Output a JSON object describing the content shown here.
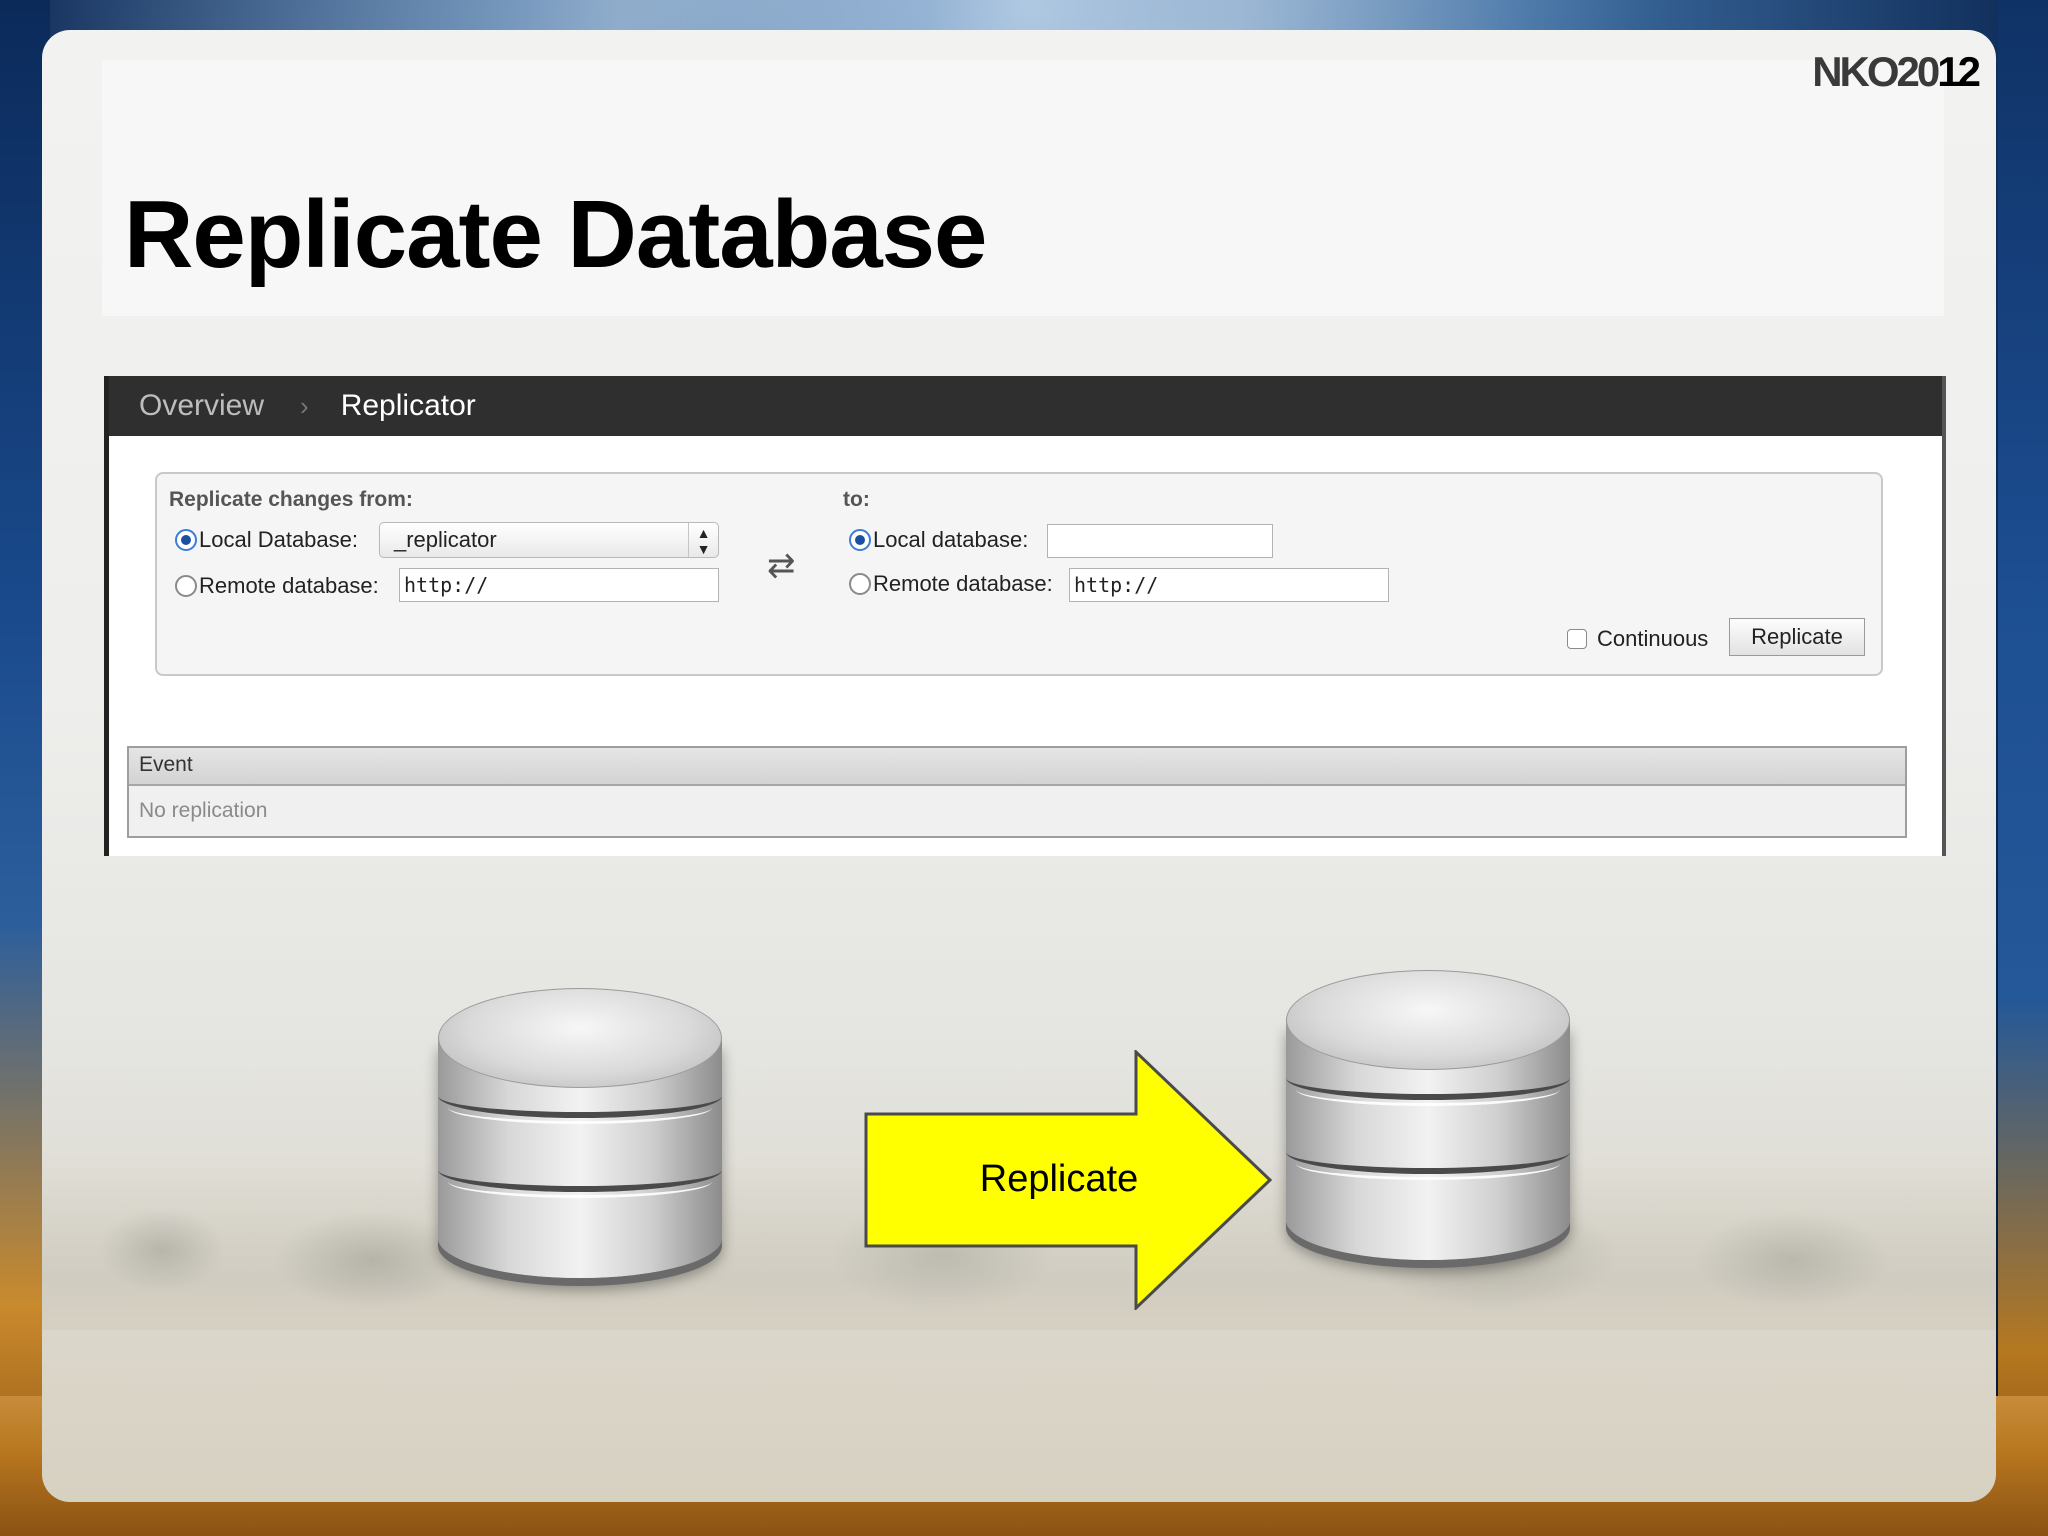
{
  "slide": {
    "title": "Replicate Database",
    "logo_prefix": "NKO20",
    "logo_suffix": "12"
  },
  "app": {
    "breadcrumb": {
      "items": [
        "Overview",
        "Replicator"
      ],
      "separator": "›"
    },
    "form": {
      "from_label": "Replicate changes from:",
      "to_label": "to:",
      "source": {
        "local_label": "Local Database:",
        "local_selected": true,
        "local_value": "_replicator",
        "remote_label": "Remote database:",
        "remote_value": "http://"
      },
      "target": {
        "local_label": "Local database:",
        "local_selected": true,
        "local_value": "",
        "remote_label": "Remote database:",
        "remote_value": "http://"
      },
      "swap_icon": "swap-arrows-icon",
      "continuous_label": "Continuous",
      "continuous_checked": false,
      "replicate_button": "Replicate"
    },
    "events": {
      "header": "Event",
      "empty_text": "No replication"
    }
  },
  "diagram": {
    "arrow_label": "Replicate",
    "arrow_color": "#ffff00",
    "source_icon": "database-icon",
    "target_icon": "database-icon"
  }
}
